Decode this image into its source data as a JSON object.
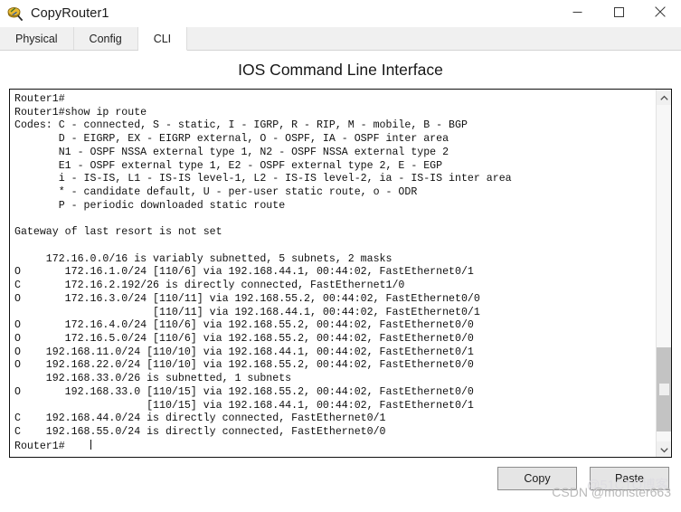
{
  "window": {
    "title": "CopyRouter1",
    "icon": "router-device-icon",
    "controls": {
      "minimize": "minimize-icon",
      "maximize": "maximize-icon",
      "close": "close-icon"
    }
  },
  "tabs": [
    {
      "label": "Physical",
      "active": false
    },
    {
      "label": "Config",
      "active": false
    },
    {
      "label": "CLI",
      "active": true
    }
  ],
  "heading": "IOS Command Line Interface",
  "terminal": {
    "lines": [
      "Router1#",
      "Router1#show ip route",
      "Codes: C - connected, S - static, I - IGRP, R - RIP, M - mobile, B - BGP",
      "       D - EIGRP, EX - EIGRP external, O - OSPF, IA - OSPF inter area",
      "       N1 - OSPF NSSA external type 1, N2 - OSPF NSSA external type 2",
      "       E1 - OSPF external type 1, E2 - OSPF external type 2, E - EGP",
      "       i - IS-IS, L1 - IS-IS level-1, L2 - IS-IS level-2, ia - IS-IS inter area",
      "       * - candidate default, U - per-user static route, o - ODR",
      "       P - periodic downloaded static route",
      "",
      "Gateway of last resort is not set",
      "",
      "     172.16.0.0/16 is variably subnetted, 5 subnets, 2 masks",
      "O       172.16.1.0/24 [110/6] via 192.168.44.1, 00:44:02, FastEthernet0/1",
      "C       172.16.2.192/26 is directly connected, FastEthernet1/0",
      "O       172.16.3.0/24 [110/11] via 192.168.55.2, 00:44:02, FastEthernet0/0",
      "                      [110/11] via 192.168.44.1, 00:44:02, FastEthernet0/1",
      "O       172.16.4.0/24 [110/6] via 192.168.55.2, 00:44:02, FastEthernet0/0",
      "O       172.16.5.0/24 [110/6] via 192.168.55.2, 00:44:02, FastEthernet0/0",
      "O    192.168.11.0/24 [110/10] via 192.168.44.1, 00:44:02, FastEthernet0/1",
      "O    192.168.22.0/24 [110/10] via 192.168.55.2, 00:44:02, FastEthernet0/0",
      "     192.168.33.0/26 is subnetted, 1 subnets",
      "O       192.168.33.0 [110/15] via 192.168.55.2, 00:44:02, FastEthernet0/0",
      "                     [110/15] via 192.168.44.1, 00:44:02, FastEthernet0/1",
      "C    192.168.44.0/24 is directly connected, FastEthernet0/1",
      "C    192.168.55.0/24 is directly connected, FastEthernet0/0"
    ],
    "prompt": "Router1#",
    "cursor_visible": true
  },
  "scrollbar": {
    "up_arrow": "chevron-up-icon",
    "down_arrow": "chevron-down-icon",
    "thumb_top_percent": 72,
    "thumb_height_percent": 25
  },
  "footer": {
    "copy_label": "Copy",
    "paste_label": "Paste"
  },
  "watermarks": {
    "csdn": "CSDN @monster663",
    "cto": "@51CTO博客"
  },
  "colors": {
    "window_bg": "#ffffff",
    "tabbar_bg": "#f0f0f0",
    "terminal_text": "#101010",
    "terminal_border": "#101010",
    "button_bg": "#e5e5e5",
    "scrollbar_thumb": "#c3c3c3"
  }
}
